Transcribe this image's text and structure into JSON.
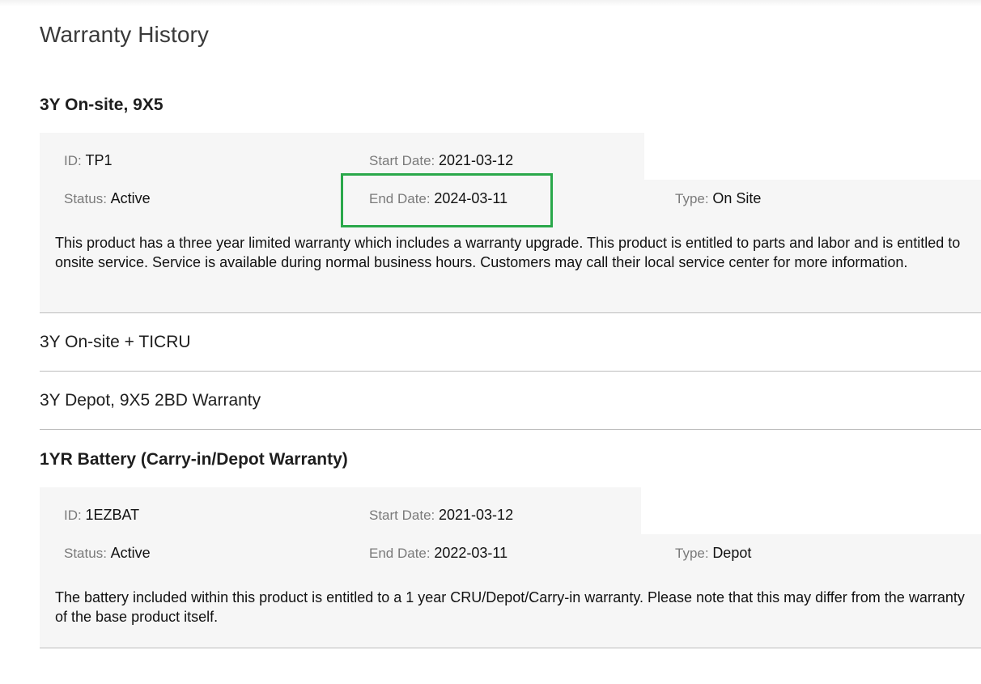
{
  "page": {
    "title": "Warranty History"
  },
  "warranties": [
    {
      "name": "3Y On-site, 9X5",
      "expanded": true,
      "id_label": "ID",
      "id_value": "TP1",
      "start_label": "Start Date",
      "start_value": "2021-03-12",
      "status_label": "Status",
      "status_value": "Active",
      "end_label": "End Date",
      "end_value": "2024-03-11",
      "type_label": "Type",
      "type_value": "On Site",
      "description": "This product has a three year limited warranty which includes a warranty upgrade. This product is entitled to parts and labor and is entitled to onsite service. Service is available during normal business hours. Customers may call their local service center for more information."
    },
    {
      "name": "3Y On-site + TICRU",
      "expanded": false
    },
    {
      "name": "3Y Depot, 9X5 2BD Warranty",
      "expanded": false
    },
    {
      "name": "1YR Battery (Carry-in/Depot Warranty)",
      "expanded": true,
      "id_label": "ID",
      "id_value": "1EZBAT",
      "start_label": "Start Date",
      "start_value": "2021-03-12",
      "status_label": "Status",
      "status_value": "Active",
      "end_label": "End Date",
      "end_value": "2022-03-11",
      "type_label": "Type",
      "type_value": "Depot",
      "description": "The battery included within this product is entitled to a 1 year CRU/Depot/Carry-in warranty. Please note that this may differ from the warranty of the base product itself."
    }
  ],
  "colors": {
    "highlight": "#2aa84a",
    "panel_bg": "#f6f6f6",
    "divider": "#bdbdbd",
    "label_gray": "#7a7a7a"
  }
}
